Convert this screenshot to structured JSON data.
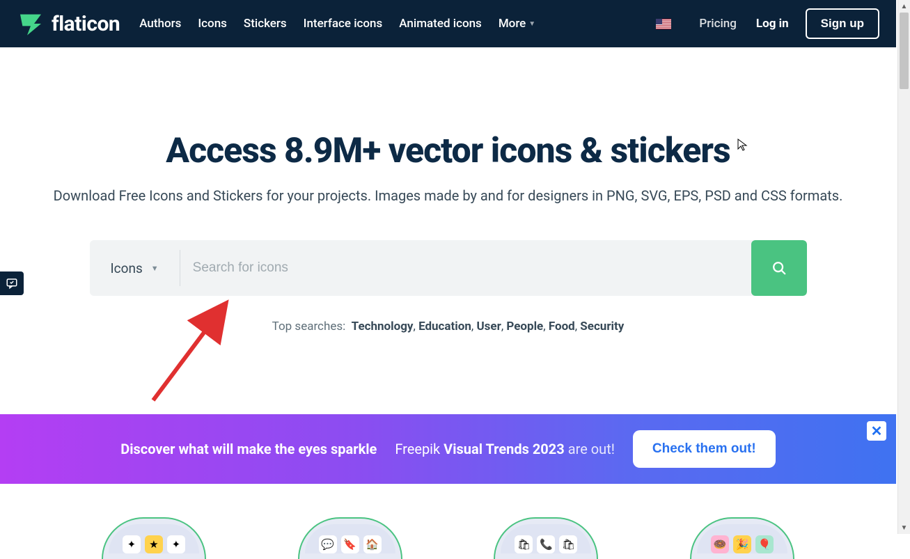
{
  "header": {
    "logo_text": "flaticon",
    "nav": [
      "Authors",
      "Icons",
      "Stickers",
      "Interface icons",
      "Animated icons",
      "More"
    ],
    "pricing": "Pricing",
    "login": "Log in",
    "signup": "Sign up"
  },
  "hero": {
    "title": "Access 8.9M+ vector icons & stickers",
    "subtitle": "Download Free Icons and Stickers for your projects. Images made by and for designers in PNG, SVG, EPS, PSD and CSS formats."
  },
  "search": {
    "type_label": "Icons",
    "placeholder": "Search for icons"
  },
  "top_searches": {
    "label": "Top searches:",
    "items": [
      "Technology",
      "Education",
      "User",
      "People",
      "Food",
      "Security"
    ]
  },
  "promo": {
    "text1": "Discover what will make the eyes sparkle",
    "freepik": "Freepik",
    "trends": "Visual Trends 2023",
    "out": "are out!",
    "cta": "Check them out!",
    "close": "✕"
  }
}
